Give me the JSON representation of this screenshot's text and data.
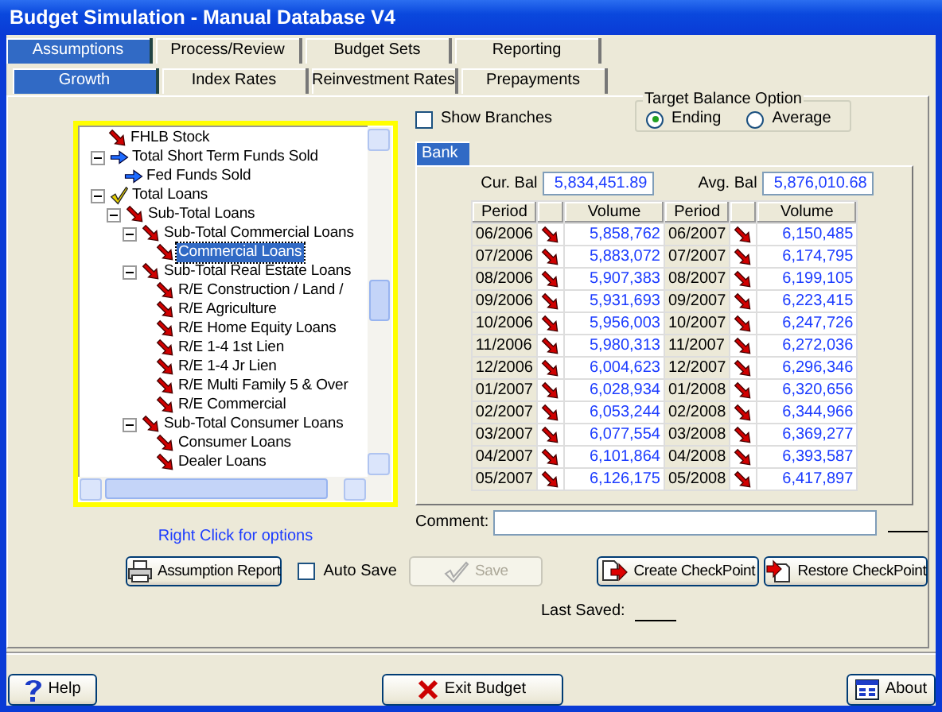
{
  "window": {
    "title": "Budget Simulation - Manual Database V4"
  },
  "main_tabs": [
    {
      "label": "Assumptions",
      "selected": true
    },
    {
      "label": "Process/Review",
      "selected": false
    },
    {
      "label": "Budget Sets",
      "selected": false
    },
    {
      "label": "Reporting",
      "selected": false
    }
  ],
  "sub_tabs": [
    {
      "label": "Growth",
      "selected": true
    },
    {
      "label": "Index Rates",
      "selected": false
    },
    {
      "label": "Reinvestment Rates",
      "selected": false
    },
    {
      "label": "Prepayments",
      "selected": false
    }
  ],
  "tree": {
    "items": [
      {
        "label": "FHLB Stock",
        "kind": "down",
        "selected": false
      },
      {
        "label": "Total Short Term Funds Sold",
        "kind": "right",
        "selected": false,
        "expanded": true,
        "children": [
          {
            "label": "Fed Funds Sold",
            "kind": "right",
            "selected": false
          }
        ]
      },
      {
        "label": "Total Loans",
        "kind": "check",
        "selected": false,
        "expanded": true,
        "children": [
          {
            "label": "Sub-Total Loans",
            "kind": "down",
            "selected": false,
            "expanded": true,
            "children": [
              {
                "label": "Sub-Total Commercial Loans",
                "kind": "down",
                "selected": false,
                "expanded": true,
                "children": [
                  {
                    "label": "Commercial Loans",
                    "kind": "down",
                    "selected": true
                  }
                ]
              },
              {
                "label": "Sub-Total Real Estate Loans",
                "kind": "down",
                "selected": false,
                "expanded": true,
                "children": [
                  {
                    "label": "R/E Construction / Land /",
                    "kind": "down",
                    "selected": false
                  },
                  {
                    "label": "R/E Agriculture",
                    "kind": "down",
                    "selected": false
                  },
                  {
                    "label": "R/E Home Equity Loans",
                    "kind": "down",
                    "selected": false
                  },
                  {
                    "label": "R/E 1-4 1st Lien",
                    "kind": "down",
                    "selected": false
                  },
                  {
                    "label": "R/E 1-4 Jr Lien",
                    "kind": "down",
                    "selected": false
                  },
                  {
                    "label": "R/E Multi Family 5 & Over",
                    "kind": "down",
                    "selected": false
                  },
                  {
                    "label": "R/E Commercial",
                    "kind": "down",
                    "selected": false
                  }
                ]
              },
              {
                "label": "Sub-Total Consumer Loans",
                "kind": "down",
                "selected": false,
                "expanded": true,
                "children": [
                  {
                    "label": "Consumer Loans",
                    "kind": "down",
                    "selected": false
                  },
                  {
                    "label": "Dealer Loans",
                    "kind": "down",
                    "selected": false
                  }
                ]
              }
            ]
          }
        ]
      }
    ],
    "hint": "Right Click for options"
  },
  "show_branches": {
    "label": "Show Branches",
    "checked": false
  },
  "target_balance_option": {
    "title": "Target Balance Option",
    "options": [
      {
        "label": "Ending",
        "selected": true
      },
      {
        "label": "Average",
        "selected": false
      }
    ]
  },
  "entity_tabs": [
    {
      "label": "Bank",
      "selected": true
    }
  ],
  "balances": [
    {
      "label": "Cur. Bal",
      "value": "5,834,451.89"
    },
    {
      "label": "Avg. Bal",
      "value": "5,876,010.68"
    }
  ],
  "grid": {
    "columns": [
      {
        "kind": "text",
        "label": "Period"
      },
      {
        "kind": "icon"
      },
      {
        "kind": "text",
        "label": "Volume"
      },
      {
        "kind": "text",
        "label": "Period"
      },
      {
        "kind": "icon"
      },
      {
        "kind": "text",
        "label": "Volume"
      }
    ],
    "rows": [
      {
        "left": {
          "period": "06/2006",
          "kind": "down",
          "volume": "5,858,762"
        },
        "right": {
          "period": "06/2007",
          "kind": "down",
          "volume": "6,150,485"
        }
      },
      {
        "left": {
          "period": "07/2006",
          "kind": "down",
          "volume": "5,883,072"
        },
        "right": {
          "period": "07/2007",
          "kind": "down",
          "volume": "6,174,795"
        }
      },
      {
        "left": {
          "period": "08/2006",
          "kind": "down",
          "volume": "5,907,383"
        },
        "right": {
          "period": "08/2007",
          "kind": "down",
          "volume": "6,199,105"
        }
      },
      {
        "left": {
          "period": "09/2006",
          "kind": "down",
          "volume": "5,931,693"
        },
        "right": {
          "period": "09/2007",
          "kind": "down",
          "volume": "6,223,415"
        }
      },
      {
        "left": {
          "period": "10/2006",
          "kind": "down",
          "volume": "5,956,003"
        },
        "right": {
          "period": "10/2007",
          "kind": "down",
          "volume": "6,247,726"
        }
      },
      {
        "left": {
          "period": "11/2006",
          "kind": "down",
          "volume": "5,980,313"
        },
        "right": {
          "period": "11/2007",
          "kind": "down",
          "volume": "6,272,036"
        }
      },
      {
        "left": {
          "period": "12/2006",
          "kind": "down",
          "volume": "6,004,623"
        },
        "right": {
          "period": "12/2007",
          "kind": "down",
          "volume": "6,296,346"
        }
      },
      {
        "left": {
          "period": "01/2007",
          "kind": "down",
          "volume": "6,028,934"
        },
        "right": {
          "period": "01/2008",
          "kind": "down",
          "volume": "6,320,656"
        }
      },
      {
        "left": {
          "period": "02/2007",
          "kind": "down",
          "volume": "6,053,244"
        },
        "right": {
          "period": "02/2008",
          "kind": "down",
          "volume": "6,344,966"
        }
      },
      {
        "left": {
          "period": "03/2007",
          "kind": "down",
          "volume": "6,077,554"
        },
        "right": {
          "period": "03/2008",
          "kind": "down",
          "volume": "6,369,277"
        }
      },
      {
        "left": {
          "period": "04/2007",
          "kind": "down",
          "volume": "6,101,864"
        },
        "right": {
          "period": "04/2008",
          "kind": "down",
          "volume": "6,393,587"
        }
      },
      {
        "left": {
          "period": "05/2007",
          "kind": "down",
          "volume": "6,126,175"
        },
        "right": {
          "period": "05/2008",
          "kind": "down",
          "volume": "6,417,897"
        }
      }
    ]
  },
  "comment": {
    "label": "Comment:"
  },
  "actions": [
    {
      "kind": "report",
      "label": "Assumption Report",
      "disabled": false
    },
    {
      "kind": "checkbox",
      "label": "Auto Save",
      "checked": false
    },
    {
      "kind": "save",
      "label": "Save",
      "disabled": true
    },
    {
      "kind": "create",
      "label": "Create CheckPoint",
      "disabled": false
    },
    {
      "kind": "restore",
      "label": "Restore CheckPoint",
      "disabled": false
    }
  ],
  "last_saved": {
    "label": "Last Saved:"
  },
  "footer": [
    {
      "kind": "help",
      "label": "Help"
    },
    {
      "kind": "exit",
      "label": "Exit Budget"
    },
    {
      "kind": "about",
      "label": "About"
    }
  ]
}
